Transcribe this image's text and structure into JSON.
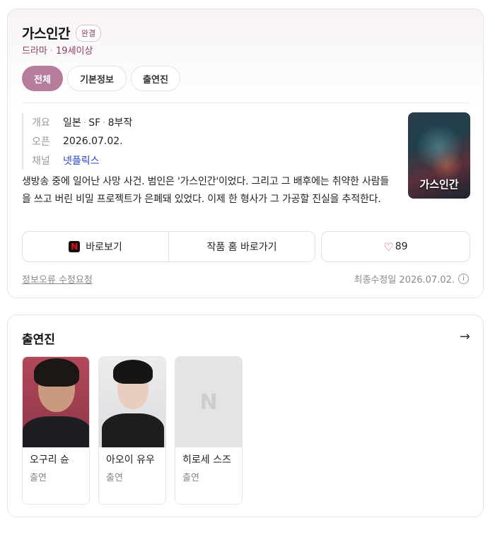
{
  "info": {
    "title": "가스인간",
    "status_badge": "완결",
    "genre": "드라마",
    "rating": "19세이상",
    "tabs": [
      {
        "label": "전체"
      },
      {
        "label": "기본정보"
      },
      {
        "label": "출연진"
      }
    ],
    "meta": {
      "overview_key": "개요",
      "country": "일본",
      "genre2": "SF",
      "episodes": "8부작",
      "open_key": "오픈",
      "open_date": "2026.07.02.",
      "channel_key": "채널",
      "channel": "넷플릭스"
    },
    "description": "생방송 중에 일어난 사망 사건. 범인은 '가스인간'이었다. 그리고 그 배후에는 취약한 사람들을 쓰고 버린 비밀 프로젝트가 은폐돼 있었다. 이제 한 형사가 그 가공할 진실을 추적한다.",
    "poster_title": "가스인간",
    "actions": {
      "watch_label": "바로보기",
      "home_label": "작품 홈 바로가기",
      "like_count": "89"
    },
    "report_label": "정보오류 수정요청",
    "updated_label": "최종수정일 2026.07.02."
  },
  "cast": {
    "title": "출연진",
    "members": [
      {
        "name": "오구리 슌",
        "role": "출연"
      },
      {
        "name": "아오이 유우",
        "role": "출연"
      },
      {
        "name": "히로세 스즈",
        "role": "출연"
      }
    ]
  },
  "colors": {
    "accent": "#b77c9c",
    "accent_text": "#8a3d66",
    "link": "#2a47c9",
    "heart": "#e0405a"
  },
  "icons": {
    "netflix": "netflix-icon",
    "heart": "heart-icon",
    "info": "info-icon",
    "arrow": "arrow-right-icon",
    "placeholder": "n-placeholder-icon"
  }
}
